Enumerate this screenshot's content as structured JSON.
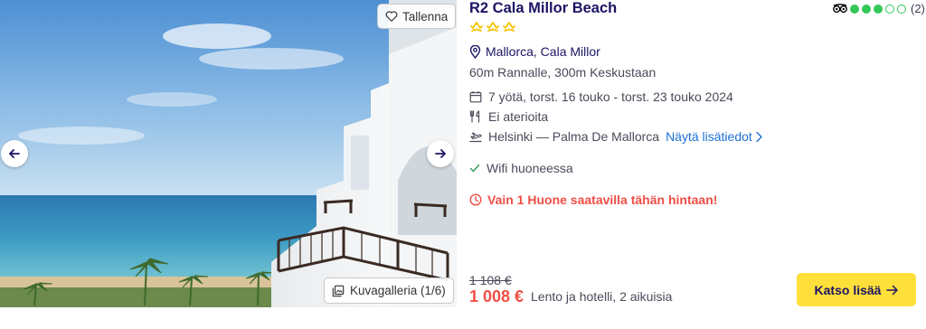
{
  "photo": {
    "save_label": "Tallenna",
    "gallery_label": "Kuvagalleria (1/6)"
  },
  "hotel": {
    "name": "R2 Cala Millor Beach",
    "star_count": 3,
    "rating_dots_filled": 3,
    "rating_dots_total": 5,
    "review_count": "(2)",
    "location": "Mallorca, Cala Millor",
    "distance": "60m Rannalle, 300m Keskustaan"
  },
  "trip": {
    "dates": "7 yötä, torst. 16 touko - torst. 23 touko 2024",
    "meals": "Ei aterioita",
    "flight": "Helsinki — Palma De Mallorca",
    "details_link": "Näytä lisätiedot"
  },
  "amenity": {
    "wifi": "Wifi huoneessa"
  },
  "urgency": "Vain 1 Huone saatavilla tähän hintaan!",
  "price": {
    "old": "1 108 €",
    "new": "1 008 €",
    "note": "Lento ja hotelli, 2 aikuisia"
  },
  "cta_label": "Katso lisää",
  "colors": {
    "title": "#1b1464",
    "star": "#f5c400",
    "rating": "#34c759",
    "urgency": "#f04e45",
    "link": "#1d6fd6",
    "cta_bg": "#ffdf3a"
  }
}
